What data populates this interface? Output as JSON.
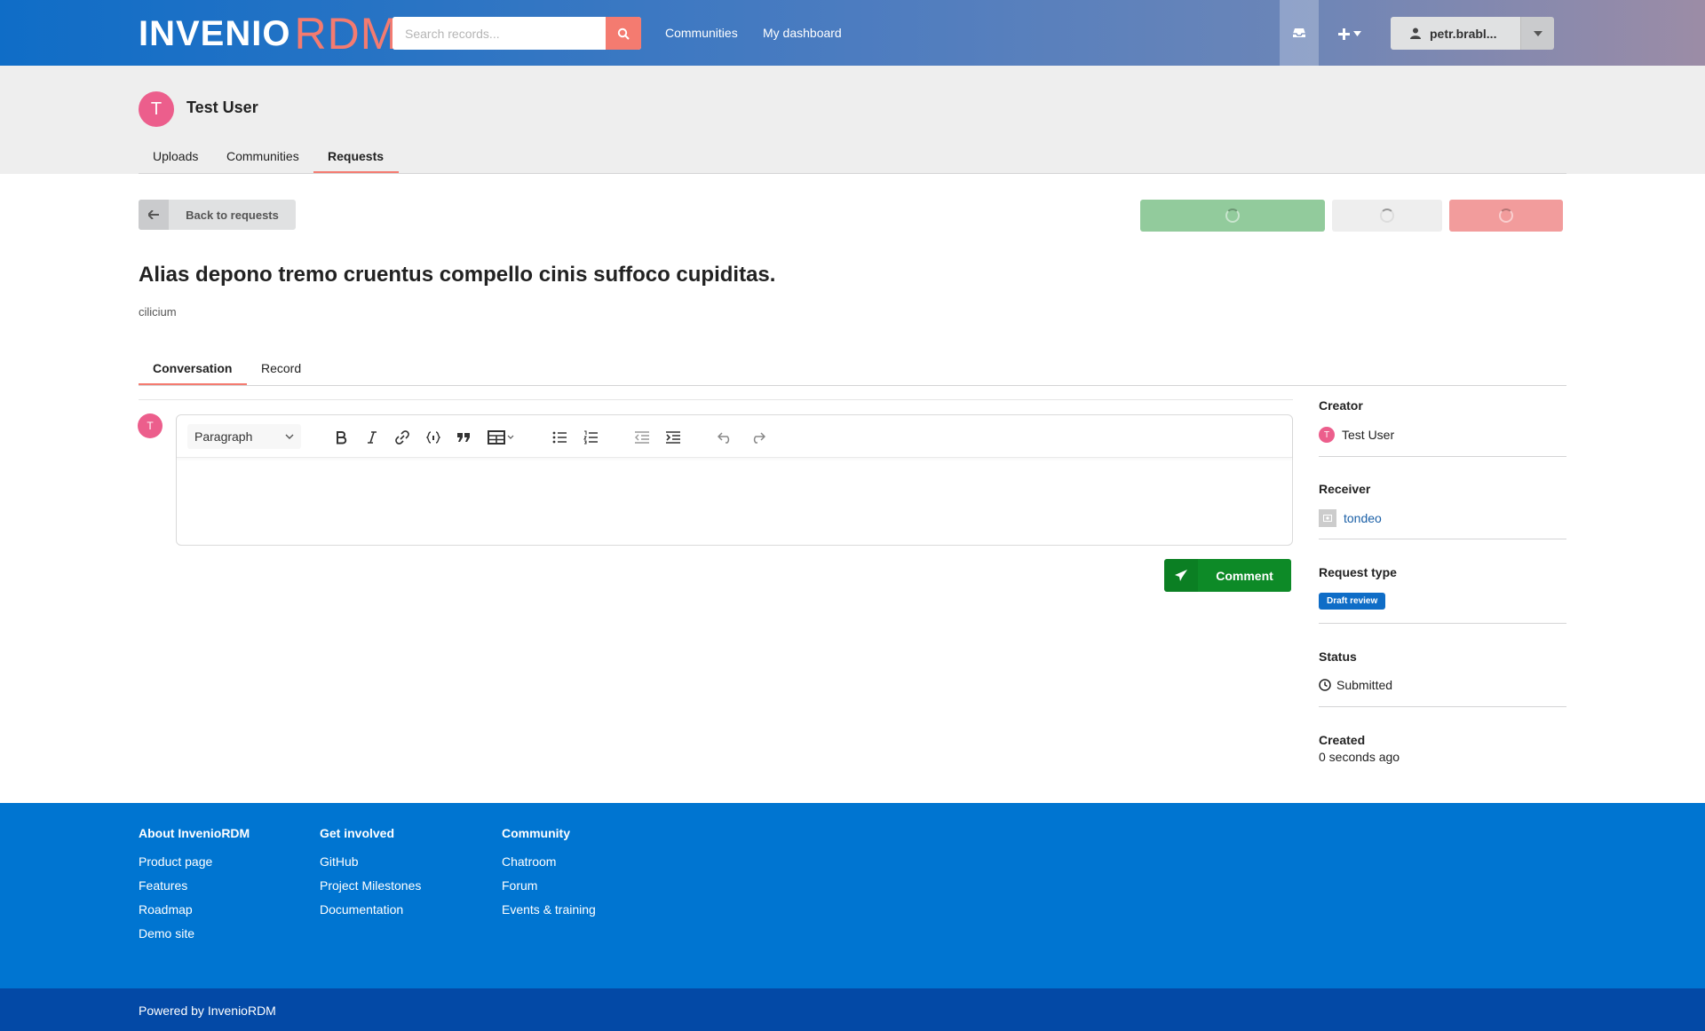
{
  "header": {
    "logo_invenio": "INVENIO",
    "logo_rdm": "RDM",
    "search_placeholder": "Search records...",
    "nav": [
      "Communities",
      "My dashboard"
    ],
    "user": "petr.brabl..."
  },
  "profile": {
    "initial": "T",
    "name": "Test User",
    "tabs": [
      "Uploads",
      "Communities",
      "Requests"
    ],
    "active_tab": "Requests"
  },
  "actions": {
    "back_label": "Back to requests",
    "accept_color": "#92cb9c",
    "neutral_color": "#eeeeee",
    "decline_color": "#f29c9c"
  },
  "request": {
    "title": "Alias depono tremo cruentus compello cinis suffoco cupiditas.",
    "subtitle": "cilicium",
    "tabs": [
      "Conversation",
      "Record"
    ],
    "active_tab": "Conversation"
  },
  "editor": {
    "avatar_initial": "T",
    "format_select": "Paragraph",
    "toolbar_icons": [
      "bold-icon",
      "italic-icon",
      "link-icon",
      "code-icon",
      "blockquote-icon",
      "table-icon",
      "bullet-list-icon",
      "numbered-list-icon",
      "outdent-icon",
      "indent-icon",
      "undo-icon",
      "redo-icon"
    ],
    "comment_label": "Comment"
  },
  "sidebar": {
    "creator_label": "Creator",
    "creator_initial": "T",
    "creator_name": "Test User",
    "receiver_label": "Receiver",
    "receiver_name": "tondeo",
    "type_label": "Request type",
    "type_value": "Draft review",
    "status_label": "Status",
    "status_value": "Submitted",
    "created_label": "Created",
    "created_value": "0 seconds ago"
  },
  "footer": {
    "columns": [
      {
        "title": "About InvenioRDM",
        "links": [
          "Product page",
          "Features",
          "Roadmap",
          "Demo site"
        ]
      },
      {
        "title": "Get involved",
        "links": [
          "GitHub",
          "Project Milestones",
          "Documentation"
        ]
      },
      {
        "title": "Community",
        "links": [
          "Chatroom",
          "Forum",
          "Events & training"
        ]
      }
    ],
    "powered": "Powered by InvenioRDM"
  }
}
